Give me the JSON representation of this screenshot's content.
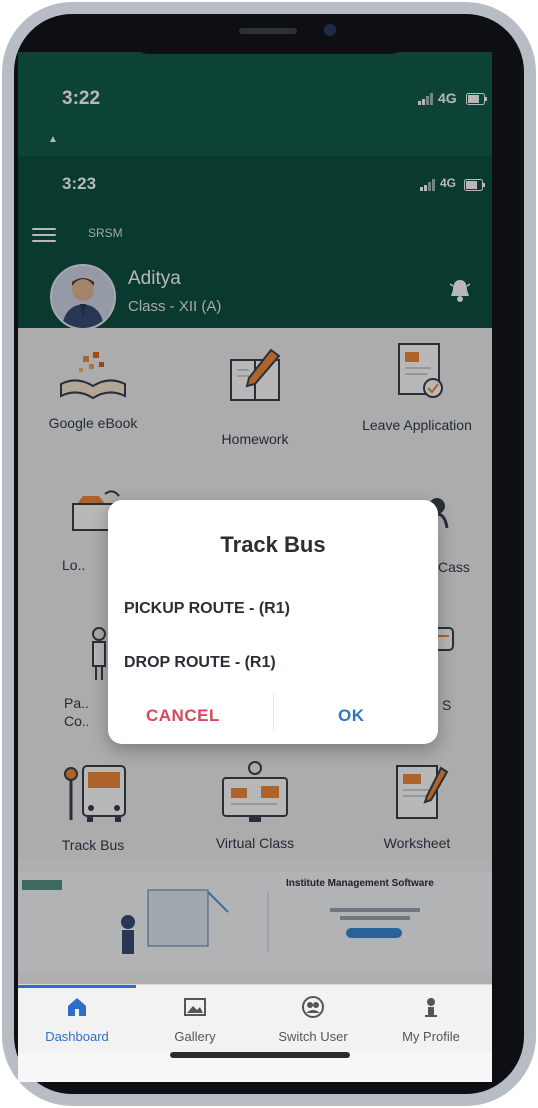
{
  "status_outer": {
    "time": "3:22",
    "network": "4G"
  },
  "status_inner": {
    "time": "3:23",
    "network": "4G"
  },
  "header": {
    "school": "SRSM",
    "student_name": "Aditya",
    "student_class": "Class - XII (A)"
  },
  "tiles": [
    {
      "label": "Google eBook",
      "icon": "book-icon"
    },
    {
      "label": "Homework",
      "icon": "homework-icon"
    },
    {
      "label": "Leave Application",
      "icon": "leave-icon"
    },
    {
      "label": "Lo... Fo...",
      "icon": "lost-found-icon"
    },
    {
      "label": "Cass",
      "icon": "class-icon"
    },
    {
      "label": "Pa... Co...",
      "icon": "parent-icon"
    },
    {
      "label": "S",
      "icon": "sms-icon"
    },
    {
      "label": "Track Bus",
      "icon": "bus-icon"
    },
    {
      "label": "Virtual Class",
      "icon": "virtual-class-icon"
    },
    {
      "label": "Worksheet",
      "icon": "worksheet-icon"
    }
  ],
  "banner": {
    "title": "Institute Management Software"
  },
  "dialog": {
    "title": "Track Bus",
    "options": [
      "PICKUP ROUTE - (R1)",
      "DROP ROUTE - (R1)"
    ],
    "cancel": "CANCEL",
    "ok": "OK",
    "cancel_color": "#d9475c",
    "ok_color": "#2f74c8"
  },
  "bottom_nav": [
    {
      "label": "Dashboard",
      "icon": "home-icon",
      "active": true
    },
    {
      "label": "Gallery",
      "icon": "gallery-icon",
      "active": false
    },
    {
      "label": "Switch User",
      "icon": "switch-user-icon",
      "active": false
    },
    {
      "label": "My Profile",
      "icon": "profile-icon",
      "active": false
    }
  ],
  "colors": {
    "header_bg": "#0f4f42",
    "status_bg": "#125c4d",
    "accent": "#2d6fc8"
  }
}
